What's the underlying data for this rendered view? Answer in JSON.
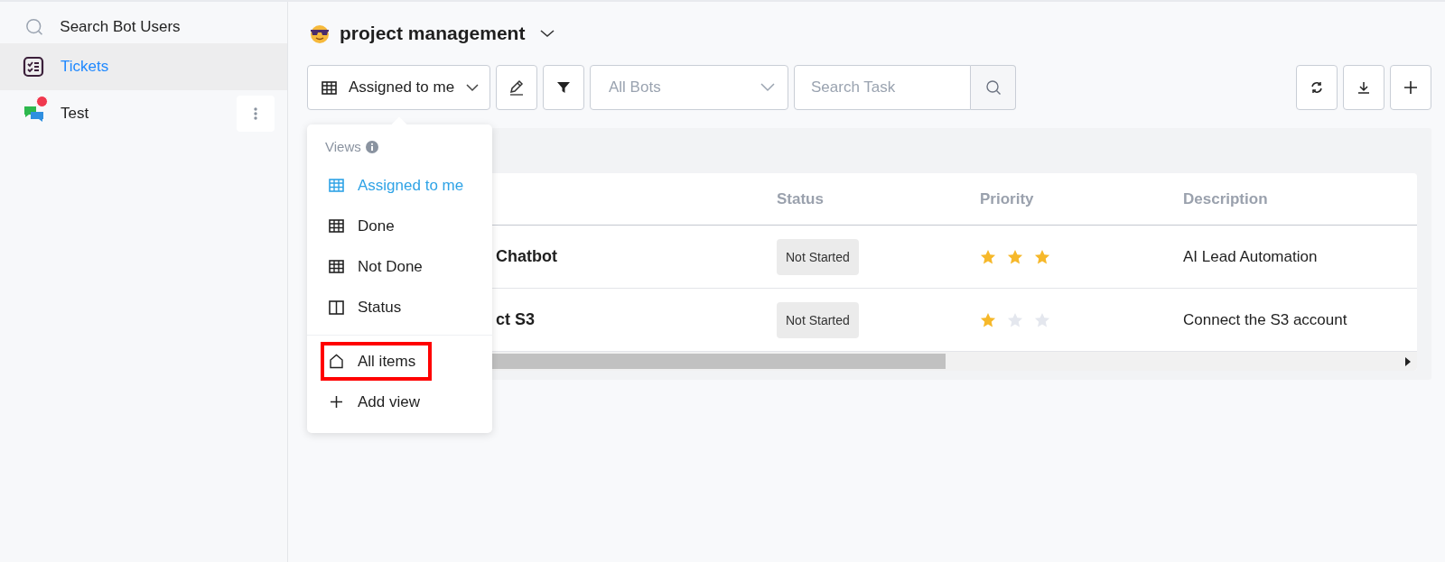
{
  "sidebar": {
    "search": {
      "placeholder": "Search Bot Users"
    },
    "items": [
      {
        "label": "Tickets",
        "kind": "tickets",
        "selected": true,
        "badge": false
      },
      {
        "label": "Test",
        "kind": "chat",
        "selected": false,
        "badge": true
      }
    ]
  },
  "header": {
    "title": "project management"
  },
  "toolbar": {
    "view_button": "Assigned to me",
    "bot_select": {
      "placeholder": "All Bots"
    },
    "search": {
      "placeholder": "Search Task"
    }
  },
  "views_menu": {
    "heading": "Views",
    "items": [
      {
        "label": "Assigned to me",
        "kind": "table",
        "selected": true,
        "highlighted": false
      },
      {
        "label": "Done",
        "kind": "table",
        "selected": false,
        "highlighted": false
      },
      {
        "label": "Not Done",
        "kind": "table",
        "selected": false,
        "highlighted": false
      },
      {
        "label": "Status",
        "kind": "board",
        "selected": false,
        "highlighted": false
      }
    ],
    "footer_items": [
      {
        "label": "All items",
        "kind": "home",
        "highlighted": true
      },
      {
        "label": "Add view",
        "kind": "add",
        "highlighted": false
      }
    ]
  },
  "table": {
    "columns": [
      "Status",
      "Priority",
      "Description"
    ],
    "rows": [
      {
        "column_1": "Chatbot",
        "status": "Not Started",
        "stars": 3,
        "description": "AI Lead Automation"
      },
      {
        "column_1": "ct S3",
        "status": "Not Started",
        "stars": 1,
        "description": "Connect the S3 account"
      }
    ]
  }
}
